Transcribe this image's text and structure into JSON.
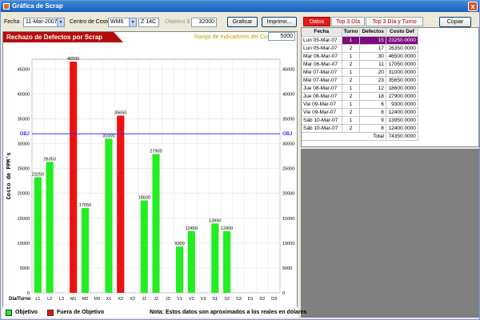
{
  "window": {
    "title": "Gráfica de Scrap",
    "close_label": "x"
  },
  "toolbar": {
    "fecha_label": "Fecha",
    "fecha_value": "11-Mar-2007",
    "centro_label": "Centro de Costo",
    "centro_value": "WM6",
    "zone_value": "Z 14C",
    "objetivo_label": "Objetivo $",
    "objetivo_value": "32000",
    "graficar_label": "Graficar",
    "imprimir_label": "Imprimir...",
    "copiar_label": "Copiar",
    "rango_label": "Rango de Indicadores del Costo",
    "rango_value": "5000"
  },
  "tabs": [
    {
      "label": "Datos",
      "active": true
    },
    {
      "label": "Top 3 Día",
      "active": false
    },
    {
      "label": "Top 3 Día y Turno",
      "active": false
    }
  ],
  "grid": {
    "headers": [
      "Fecha",
      "Turno",
      "Defectos",
      "Costo Def"
    ],
    "rows": [
      [
        "Lun 05-Mar-07",
        "1",
        "15",
        "23250.0000"
      ],
      [
        "Lun 05-Mar-07",
        "2",
        "17",
        "26350.0000"
      ],
      [
        "Mar 06-Mar-07",
        "1",
        "30",
        "46500.0000"
      ],
      [
        "Mar 06-Mar-07",
        "2",
        "11",
        "17050.0000"
      ],
      [
        "Mié 07-Mar-07",
        "1",
        "20",
        "31000.0000"
      ],
      [
        "Mié 07-Mar-07",
        "2",
        "23",
        "35650.0000"
      ],
      [
        "Jue 08-Mar-07",
        "1",
        "12",
        "18600.0000"
      ],
      [
        "Jue 08-Mar-07",
        "2",
        "18",
        "27900.0000"
      ],
      [
        "Vie 09-Mar-07",
        "1",
        "6",
        "9300.0000"
      ],
      [
        "Vie 09-Mar-07",
        "2",
        "8",
        "12400.0000"
      ],
      [
        "Sáb 10-Mar-07",
        "1",
        "9",
        "13950.0000"
      ],
      [
        "Sáb 10-Mar-07",
        "2",
        "8",
        "12400.0000"
      ]
    ],
    "total_label": "Total",
    "total_value": "74350.0000"
  },
  "chart_data": {
    "type": "bar",
    "title": "Rechazo de Defectos por Scrap",
    "ylabel": "Costo de PPM's",
    "xlabel": "Día/Turno",
    "ylim": [
      0,
      47000
    ],
    "yticks": [
      0,
      5000,
      10000,
      15000,
      20000,
      25000,
      30000,
      35000,
      40000,
      45000
    ],
    "target": 32000,
    "target_label": "OBJ",
    "categories": [
      "L1",
      "L2",
      "L3",
      "M1",
      "M2",
      "M3",
      "X1",
      "X2",
      "X3",
      "J1",
      "J2",
      "J3",
      "V1",
      "V2",
      "V3",
      "S1",
      "S2",
      "S3",
      "D1",
      "D2",
      "D3"
    ],
    "values": [
      23250,
      26350,
      null,
      46500,
      17050,
      null,
      31000,
      35650,
      null,
      18600,
      27900,
      null,
      9300,
      12400,
      null,
      13950,
      12400,
      null,
      null,
      null,
      null
    ],
    "value_labels": [
      "23250",
      "26350",
      "",
      "46500",
      "17050",
      "",
      "31000",
      "35650",
      "",
      "18600",
      "27900",
      "",
      "9300",
      "12400",
      "",
      "13950",
      "12400",
      "",
      "",
      "",
      ""
    ],
    "colors": {
      "objetivo": "#22ee22",
      "fuera": "#ee1111",
      "target_line": "#3333ff"
    },
    "legend": [
      {
        "name": "Objetivo",
        "color": "#22ee22"
      },
      {
        "name": "Fuera de Objetivo",
        "color": "#ee1111"
      }
    ],
    "note": "Nota: Estos datos son aproximados a los reales en dólares"
  }
}
